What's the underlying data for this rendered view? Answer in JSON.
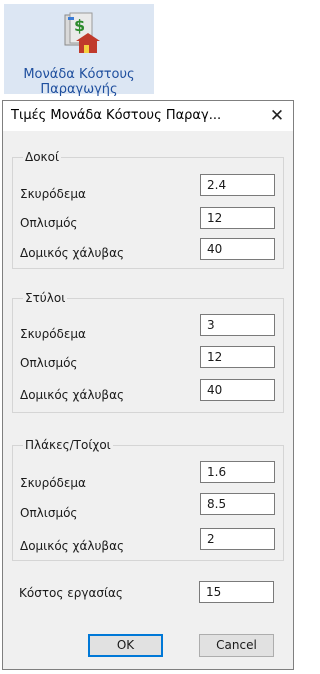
{
  "ribbon": {
    "label_line1": "Μονάδα Κόστους",
    "label_line2": "Παραγωγής",
    "icon": "money-house-icon"
  },
  "dialog": {
    "title": "Τιμές Μονάδα Κόστους Παραγ...",
    "close_label": "✕",
    "groups": [
      {
        "title": "Δοκοί",
        "rows": [
          {
            "label": "Σκυρόδεμα",
            "value": "2.4"
          },
          {
            "label": "Οπλισμός",
            "value": "12"
          },
          {
            "label": "Δομικός χάλυβας",
            "value": "40"
          }
        ]
      },
      {
        "title": "Στύλοι",
        "rows": [
          {
            "label": "Σκυρόδεμα",
            "value": "3"
          },
          {
            "label": "Οπλισμός",
            "value": "12"
          },
          {
            "label": "Δομικός χάλυβας",
            "value": "40"
          }
        ]
      },
      {
        "title": "Πλάκες/Τοίχοι",
        "rows": [
          {
            "label": "Σκυρόδεμα",
            "value": "1.6"
          },
          {
            "label": "Οπλισμός",
            "value": "8.5"
          },
          {
            "label": "Δομικός χάλυβας",
            "value": "2"
          }
        ]
      }
    ],
    "labor": {
      "label": "Κόστος εργασίας",
      "value": "15"
    },
    "buttons": {
      "ok": "OK",
      "cancel": "Cancel"
    }
  }
}
